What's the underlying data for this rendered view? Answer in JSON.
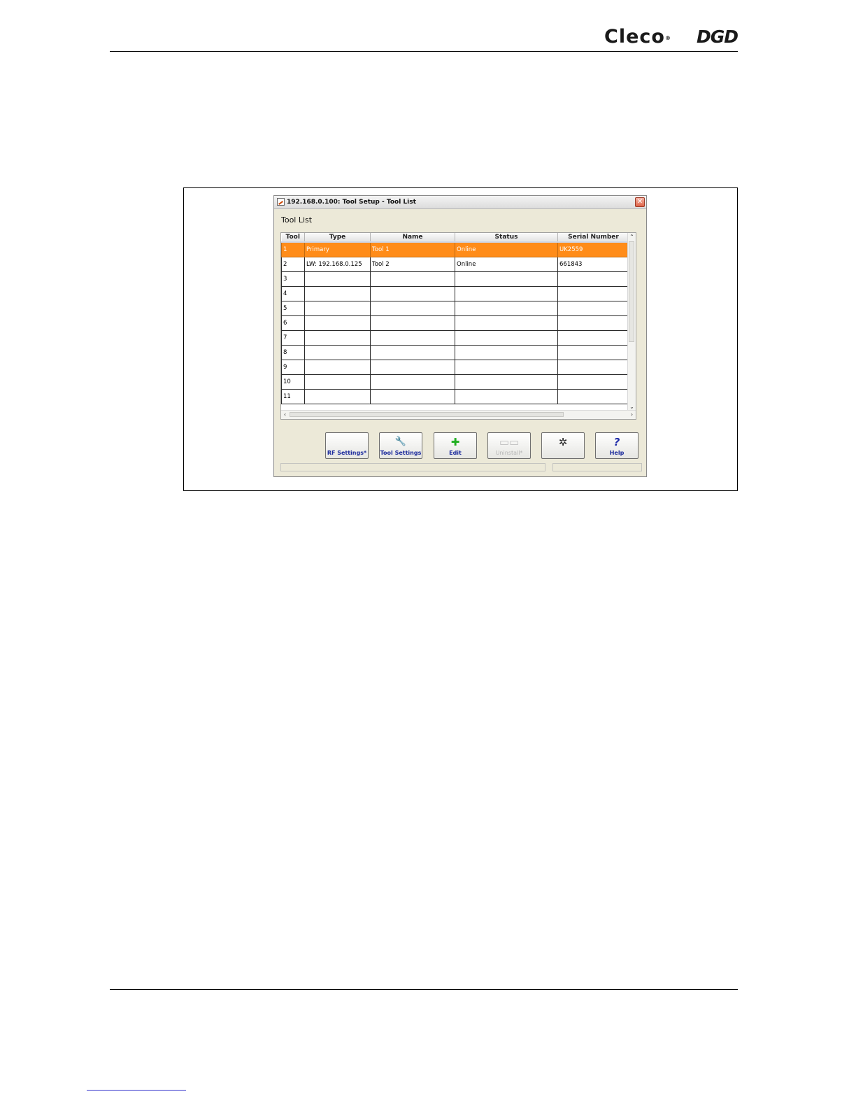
{
  "header": {
    "logo_cleco": "Cleco",
    "logo_cleco_mark": "®",
    "logo_dgd": "DGD"
  },
  "window": {
    "title": "192.168.0.100: Tool Setup - Tool List",
    "close_glyph": "✕",
    "panel_title": "Tool List"
  },
  "table": {
    "columns": [
      "Tool",
      "Type",
      "Name",
      "Status",
      "Serial Number"
    ],
    "rows": [
      {
        "tool": "1",
        "type": "Primary",
        "name": "Tool 1",
        "status": "Online",
        "serial": "UK2559"
      },
      {
        "tool": "2",
        "type": "LW: 192.168.0.125",
        "name": "Tool 2",
        "status": "Online",
        "serial": "661843"
      },
      {
        "tool": "3",
        "type": "",
        "name": "",
        "status": "",
        "serial": ""
      },
      {
        "tool": "4",
        "type": "",
        "name": "",
        "status": "",
        "serial": ""
      },
      {
        "tool": "5",
        "type": "",
        "name": "",
        "status": "",
        "serial": ""
      },
      {
        "tool": "6",
        "type": "",
        "name": "",
        "status": "",
        "serial": ""
      },
      {
        "tool": "7",
        "type": "",
        "name": "",
        "status": "",
        "serial": ""
      },
      {
        "tool": "8",
        "type": "",
        "name": "",
        "status": "",
        "serial": ""
      },
      {
        "tool": "9",
        "type": "",
        "name": "",
        "status": "",
        "serial": ""
      },
      {
        "tool": "10",
        "type": "",
        "name": "",
        "status": "",
        "serial": ""
      },
      {
        "tool": "11",
        "type": "",
        "name": "",
        "status": "",
        "serial": ""
      }
    ],
    "selected_row": 0,
    "selected_color": "#ff8c19",
    "scroll_glyphs": {
      "up": "⌃",
      "down": "⌄",
      "left": "‹",
      "right": "›"
    }
  },
  "buttons": {
    "rf_settings": {
      "label": "RF Settings*",
      "icon": ""
    },
    "tool_settings": {
      "label": "Tool Settings",
      "icon": "🔧"
    },
    "edit": {
      "label": "Edit",
      "icon": "✚"
    },
    "uninstall": {
      "label": "Uninstall*",
      "icon": "▭▭"
    },
    "network": {
      "label": "",
      "icon": "✲"
    },
    "help": {
      "label": "Help",
      "icon": "?"
    }
  },
  "icons": {
    "close": "close-icon",
    "edit": "plus-icon",
    "help": "question-icon",
    "tool_settings": "tool-icon",
    "network": "network-icon"
  }
}
